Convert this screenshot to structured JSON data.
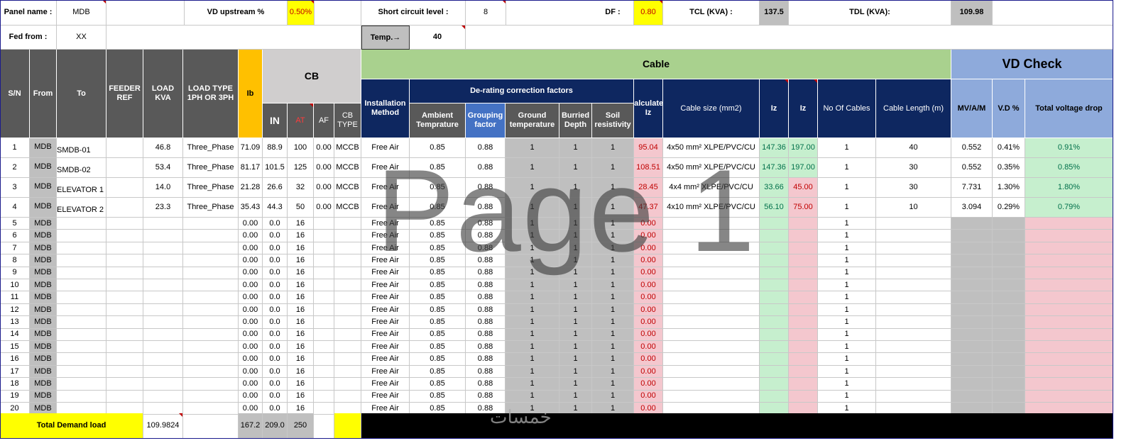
{
  "header": {
    "panel_name_label": "Panel name :",
    "panel_name_value": "MDB",
    "vd_upstream_label": "VD upstream %",
    "vd_upstream_value": "0.50%",
    "sc_level_label": "Short circuit level :",
    "sc_level_value": "8",
    "df_label": "DF :",
    "df_value": "0.80",
    "tcl_label": "TCL (KVA) :",
    "tcl_value": "137.5",
    "tdl_label": "TDL (KVA):",
    "tdl_value": "109.98",
    "fed_from_label": "Fed from :",
    "fed_from_value": "XX",
    "temp_label": "Temp.→",
    "temp_value": "40"
  },
  "columns": {
    "sn": "S/N",
    "from": "From",
    "to": "To",
    "feeder_ref": "FEEDER REF",
    "load_kva": "LOAD KVA",
    "load_type": "LOAD TYPE 1PH OR 3PH",
    "ib": "Ib",
    "cb": "CB",
    "cb_in": "IN",
    "cb_at": "AT",
    "cb_af": "AF",
    "cb_type": "CB TYPE",
    "cable": "Cable",
    "vd_check": "VD Check",
    "installation": "Installation Method",
    "derating": "De-rating correction factors",
    "ambient": "Ambient Temprature",
    "grouping": "Grouping factor",
    "ground_temp": "Ground temperature",
    "burried": "Burried Depth",
    "soil": "Soil resistivity",
    "calc_iz": "Calculated Iz",
    "cable_size": "Cable size (mm2)",
    "iz1": "Iz",
    "iz2": "Iz",
    "no_cables": "No Of Cables",
    "cable_length": "Cable Length (m)",
    "mv": "MV/A/M",
    "vd_pct": "V.D %",
    "total_vd": "Total voltage drop"
  },
  "rows": [
    {
      "sn": "1",
      "from": "MDB",
      "to": "SMDB-01",
      "feeder": "",
      "load": "46.8",
      "type": "Three_Phase",
      "ib": "71.09",
      "in": "88.9",
      "at": "100",
      "af": "0.00",
      "cbtype": "MCCB",
      "inst": "Free Air",
      "amb": "0.85",
      "grp": "0.88",
      "gt": "1",
      "bd": "1",
      "sr": "1",
      "ciz": "95.04",
      "size": "4x50 mm² XLPE/PVC/CU",
      "iz1": "147.36",
      "iz2": "197.00",
      "nc": "1",
      "len": "40",
      "mv": "0.552",
      "vd": "0.41%",
      "tvd": "0.91%"
    },
    {
      "sn": "2",
      "from": "MDB",
      "to": "SMDB-02",
      "feeder": "",
      "load": "53.4",
      "type": "Three_Phase",
      "ib": "81.17",
      "in": "101.5",
      "at": "125",
      "af": "0.00",
      "cbtype": "MCCB",
      "inst": "Free Air",
      "amb": "0.85",
      "grp": "0.88",
      "gt": "1",
      "bd": "1",
      "sr": "1",
      "ciz": "108.51",
      "size": "4x50 mm² XLPE/PVC/CU",
      "iz1": "147.36",
      "iz2": "197.00",
      "nc": "1",
      "len": "30",
      "mv": "0.552",
      "vd": "0.35%",
      "tvd": "0.85%"
    },
    {
      "sn": "3",
      "from": "MDB",
      "to": "ELEVATOR 1",
      "feeder": "",
      "load": "14.0",
      "type": "Three_Phase",
      "ib": "21.28",
      "in": "26.6",
      "at": "32",
      "af": "0.00",
      "cbtype": "MCCB",
      "inst": "Free Air",
      "amb": "0.85",
      "grp": "0.88",
      "gt": "1",
      "bd": "1",
      "sr": "1",
      "ciz": "28.45",
      "size": "4x4 mm² XLPE/PVC/CU",
      "iz1": "33.66",
      "iz2": "45.00",
      "nc": "1",
      "len": "30",
      "mv": "7.731",
      "vd": "1.30%",
      "tvd": "1.80%"
    },
    {
      "sn": "4",
      "from": "MDB",
      "to": "ELEVATOR 2",
      "feeder": "",
      "load": "23.3",
      "type": "Three_Phase",
      "ib": "35.43",
      "in": "44.3",
      "at": "50",
      "af": "0.00",
      "cbtype": "MCCB",
      "inst": "Free Air",
      "amb": "0.85",
      "grp": "0.88",
      "gt": "1",
      "bd": "1",
      "sr": "1",
      "ciz": "47.37",
      "size": "4x10 mm² XLPE/PVC/CU",
      "iz1": "56.10",
      "iz2": "75.00",
      "nc": "1",
      "len": "10",
      "mv": "3.094",
      "vd": "0.29%",
      "tvd": "0.79%"
    },
    {
      "sn": "5",
      "from": "MDB",
      "to": "",
      "feeder": "",
      "load": "",
      "type": "",
      "ib": "0.00",
      "in": "0.0",
      "at": "16",
      "af": "",
      "cbtype": "",
      "inst": "Free Air",
      "amb": "0.85",
      "grp": "0.88",
      "gt": "1",
      "bd": "1",
      "sr": "1",
      "ciz": "0.00",
      "size": "",
      "iz1": "",
      "iz2": "",
      "nc": "1",
      "len": "",
      "mv": "",
      "vd": "",
      "tvd": ""
    },
    {
      "sn": "6",
      "from": "MDB",
      "to": "",
      "feeder": "",
      "load": "",
      "type": "",
      "ib": "0.00",
      "in": "0.0",
      "at": "16",
      "af": "",
      "cbtype": "",
      "inst": "Free Air",
      "amb": "0.85",
      "grp": "0.88",
      "gt": "1",
      "bd": "1",
      "sr": "1",
      "ciz": "0.00",
      "size": "",
      "iz1": "",
      "iz2": "",
      "nc": "1",
      "len": "",
      "mv": "",
      "vd": "",
      "tvd": ""
    },
    {
      "sn": "7",
      "from": "MDB",
      "to": "",
      "feeder": "",
      "load": "",
      "type": "",
      "ib": "0.00",
      "in": "0.0",
      "at": "16",
      "af": "",
      "cbtype": "",
      "inst": "Free Air",
      "amb": "0.85",
      "grp": "0.88",
      "gt": "1",
      "bd": "1",
      "sr": "1",
      "ciz": "0.00",
      "size": "",
      "iz1": "",
      "iz2": "",
      "nc": "1",
      "len": "",
      "mv": "",
      "vd": "",
      "tvd": ""
    },
    {
      "sn": "8",
      "from": "MDB",
      "to": "",
      "feeder": "",
      "load": "",
      "type": "",
      "ib": "0.00",
      "in": "0.0",
      "at": "16",
      "af": "",
      "cbtype": "",
      "inst": "Free Air",
      "amb": "0.85",
      "grp": "0.88",
      "gt": "1",
      "bd": "1",
      "sr": "1",
      "ciz": "0.00",
      "size": "",
      "iz1": "",
      "iz2": "",
      "nc": "1",
      "len": "",
      "mv": "",
      "vd": "",
      "tvd": ""
    },
    {
      "sn": "9",
      "from": "MDB",
      "to": "",
      "feeder": "",
      "load": "",
      "type": "",
      "ib": "0.00",
      "in": "0.0",
      "at": "16",
      "af": "",
      "cbtype": "",
      "inst": "Free Air",
      "amb": "0.85",
      "grp": "0.88",
      "gt": "1",
      "bd": "1",
      "sr": "1",
      "ciz": "0.00",
      "size": "",
      "iz1": "",
      "iz2": "",
      "nc": "1",
      "len": "",
      "mv": "",
      "vd": "",
      "tvd": ""
    },
    {
      "sn": "10",
      "from": "MDB",
      "to": "",
      "feeder": "",
      "load": "",
      "type": "",
      "ib": "0.00",
      "in": "0.0",
      "at": "16",
      "af": "",
      "cbtype": "",
      "inst": "Free Air",
      "amb": "0.85",
      "grp": "0.88",
      "gt": "1",
      "bd": "1",
      "sr": "1",
      "ciz": "0.00",
      "size": "",
      "iz1": "",
      "iz2": "",
      "nc": "1",
      "len": "",
      "mv": "",
      "vd": "",
      "tvd": ""
    },
    {
      "sn": "11",
      "from": "MDB",
      "to": "",
      "feeder": "",
      "load": "",
      "type": "",
      "ib": "0.00",
      "in": "0.0",
      "at": "16",
      "af": "",
      "cbtype": "",
      "inst": "Free Air",
      "amb": "0.85",
      "grp": "0.88",
      "gt": "1",
      "bd": "1",
      "sr": "1",
      "ciz": "0.00",
      "size": "",
      "iz1": "",
      "iz2": "",
      "nc": "1",
      "len": "",
      "mv": "",
      "vd": "",
      "tvd": ""
    },
    {
      "sn": "12",
      "from": "MDB",
      "to": "",
      "feeder": "",
      "load": "",
      "type": "",
      "ib": "0.00",
      "in": "0.0",
      "at": "16",
      "af": "",
      "cbtype": "",
      "inst": "Free Air",
      "amb": "0.85",
      "grp": "0.88",
      "gt": "1",
      "bd": "1",
      "sr": "1",
      "ciz": "0.00",
      "size": "",
      "iz1": "",
      "iz2": "",
      "nc": "1",
      "len": "",
      "mv": "",
      "vd": "",
      "tvd": ""
    },
    {
      "sn": "13",
      "from": "MDB",
      "to": "",
      "feeder": "",
      "load": "",
      "type": "",
      "ib": "0.00",
      "in": "0.0",
      "at": "16",
      "af": "",
      "cbtype": "",
      "inst": "Free Air",
      "amb": "0.85",
      "grp": "0.88",
      "gt": "1",
      "bd": "1",
      "sr": "1",
      "ciz": "0.00",
      "size": "",
      "iz1": "",
      "iz2": "",
      "nc": "1",
      "len": "",
      "mv": "",
      "vd": "",
      "tvd": ""
    },
    {
      "sn": "14",
      "from": "MDB",
      "to": "",
      "feeder": "",
      "load": "",
      "type": "",
      "ib": "0.00",
      "in": "0.0",
      "at": "16",
      "af": "",
      "cbtype": "",
      "inst": "Free Air",
      "amb": "0.85",
      "grp": "0.88",
      "gt": "1",
      "bd": "1",
      "sr": "1",
      "ciz": "0.00",
      "size": "",
      "iz1": "",
      "iz2": "",
      "nc": "1",
      "len": "",
      "mv": "",
      "vd": "",
      "tvd": ""
    },
    {
      "sn": "15",
      "from": "MDB",
      "to": "",
      "feeder": "",
      "load": "",
      "type": "",
      "ib": "0.00",
      "in": "0.0",
      "at": "16",
      "af": "",
      "cbtype": "",
      "inst": "Free Air",
      "amb": "0.85",
      "grp": "0.88",
      "gt": "1",
      "bd": "1",
      "sr": "1",
      "ciz": "0.00",
      "size": "",
      "iz1": "",
      "iz2": "",
      "nc": "1",
      "len": "",
      "mv": "",
      "vd": "",
      "tvd": ""
    },
    {
      "sn": "16",
      "from": "MDB",
      "to": "",
      "feeder": "",
      "load": "",
      "type": "",
      "ib": "0.00",
      "in": "0.0",
      "at": "16",
      "af": "",
      "cbtype": "",
      "inst": "Free Air",
      "amb": "0.85",
      "grp": "0.88",
      "gt": "1",
      "bd": "1",
      "sr": "1",
      "ciz": "0.00",
      "size": "",
      "iz1": "",
      "iz2": "",
      "nc": "1",
      "len": "",
      "mv": "",
      "vd": "",
      "tvd": ""
    },
    {
      "sn": "17",
      "from": "MDB",
      "to": "",
      "feeder": "",
      "load": "",
      "type": "",
      "ib": "0.00",
      "in": "0.0",
      "at": "16",
      "af": "",
      "cbtype": "",
      "inst": "Free Air",
      "amb": "0.85",
      "grp": "0.88",
      "gt": "1",
      "bd": "1",
      "sr": "1",
      "ciz": "0.00",
      "size": "",
      "iz1": "",
      "iz2": "",
      "nc": "1",
      "len": "",
      "mv": "",
      "vd": "",
      "tvd": ""
    },
    {
      "sn": "18",
      "from": "MDB",
      "to": "",
      "feeder": "",
      "load": "",
      "type": "",
      "ib": "0.00",
      "in": "0.0",
      "at": "16",
      "af": "",
      "cbtype": "",
      "inst": "Free Air",
      "amb": "0.85",
      "grp": "0.88",
      "gt": "1",
      "bd": "1",
      "sr": "1",
      "ciz": "0.00",
      "size": "",
      "iz1": "",
      "iz2": "",
      "nc": "1",
      "len": "",
      "mv": "",
      "vd": "",
      "tvd": ""
    },
    {
      "sn": "19",
      "from": "MDB",
      "to": "",
      "feeder": "",
      "load": "",
      "type": "",
      "ib": "0.00",
      "in": "0.0",
      "at": "16",
      "af": "",
      "cbtype": "",
      "inst": "Free Air",
      "amb": "0.85",
      "grp": "0.88",
      "gt": "1",
      "bd": "1",
      "sr": "1",
      "ciz": "0.00",
      "size": "",
      "iz1": "",
      "iz2": "",
      "nc": "1",
      "len": "",
      "mv": "",
      "vd": "",
      "tvd": ""
    },
    {
      "sn": "20",
      "from": "MDB",
      "to": "",
      "feeder": "",
      "load": "",
      "type": "",
      "ib": "0.00",
      "in": "0.0",
      "at": "16",
      "af": "",
      "cbtype": "",
      "inst": "Free Air",
      "amb": "0.85",
      "grp": "0.88",
      "gt": "1",
      "bd": "1",
      "sr": "1",
      "ciz": "0.00",
      "size": "",
      "iz1": "",
      "iz2": "",
      "nc": "1",
      "len": "",
      "mv": "",
      "vd": "",
      "tvd": ""
    }
  ],
  "totals": {
    "label": "Total Demand load",
    "load": "109.9824",
    "ib": "167.2",
    "in": "209.0",
    "at": "250"
  },
  "watermark": "Page 1",
  "colors": {
    "header_dark": "#595959",
    "header_navy": "#0e2760",
    "cable_green": "#a9d18e",
    "vd_blue": "#8eaadb",
    "highlight_yellow": "#ffff00",
    "ib_orange": "#ffc000",
    "fail_pink": "#f4c7ce",
    "pass_green": "#c6efce"
  }
}
